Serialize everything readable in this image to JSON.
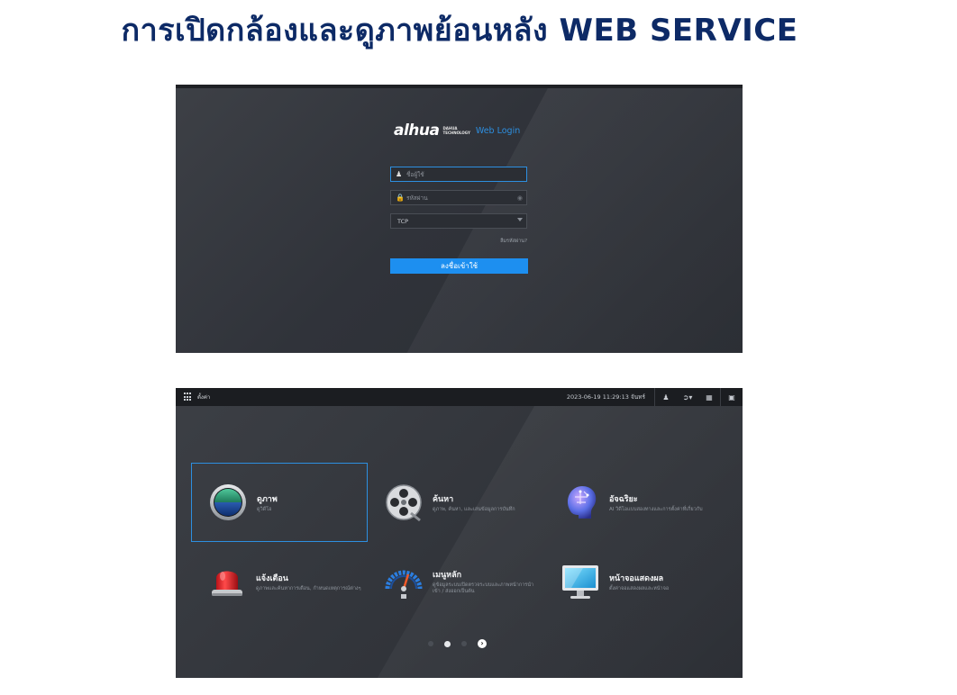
{
  "title": "การเปิดกล้องและดูภาพย้อนหลัง  WEB SERVICE",
  "login": {
    "logo_text": "alhua",
    "logo_sub_line1": "DAHUA",
    "logo_sub_line2": "TECHNOLOGY",
    "web_login": "Web Login",
    "username_placeholder": "ชื่อผู้ใช้",
    "password_placeholder": "รหัสผ่าน",
    "protocol_value": "TCP",
    "forgot_password": "ลืมรหัสผ่าน?",
    "login_button": "ลงชื่อเข้าใช้",
    "accent_color": "#1d8ff0"
  },
  "main": {
    "topbar": {
      "settings_label": "ตั้งค่า",
      "datetime": "2023-06-19 11:29:13 จันทร์"
    },
    "tiles": [
      {
        "name": "ดูภาพ",
        "desc": "ดูวิดีโอ",
        "icon": "live-view-icon"
      },
      {
        "name": "ค้นหา",
        "desc": "ดูภาพ, ค้นหา, และเล่นข้อมูลการบันทึก",
        "icon": "film-reel-icon"
      },
      {
        "name": "อัจฉริยะ",
        "desc": "AI วิดีโอแบบสองทางและการตั้งค่าที่เกี่ยวกับ",
        "icon": "ai-head-icon"
      },
      {
        "name": "แจ้งเตือน",
        "desc": "ดูภาพและค้นหาการเตือน, กำหนดเหตุการณ์ต่างๆ",
        "icon": "siren-icon"
      },
      {
        "name": "เมนูหลัก",
        "desc": "ดูข้อมูลระบบเปิดตรวจระบบและภาพหน้าการนำเข้า / ส่งออกเป็นต้น",
        "icon": "gauge-icon"
      },
      {
        "name": "หน้าจอแสดงผล",
        "desc": "ตั้งค่าจอแสดงผลและหน้าจอ",
        "icon": "monitor-icon"
      }
    ],
    "pager": {
      "pages": 3,
      "current": 2
    }
  }
}
